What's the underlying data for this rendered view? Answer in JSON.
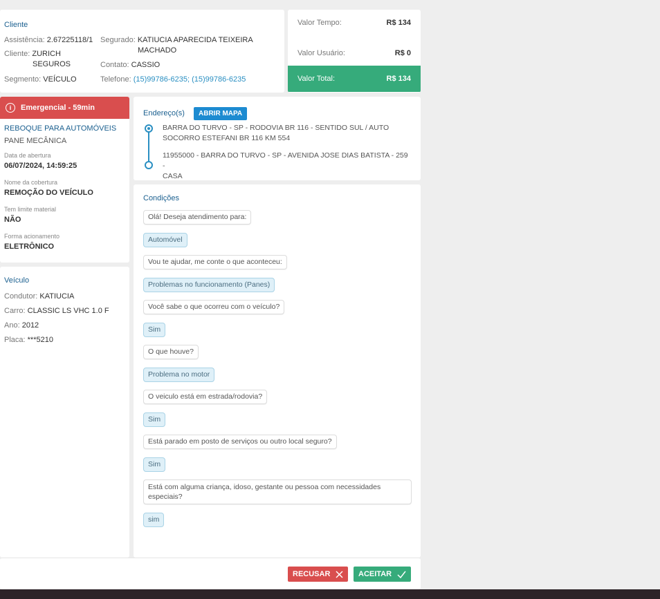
{
  "client": {
    "title": "Cliente",
    "assist_label": "Assistência:",
    "assist_value": "2.67225118/1",
    "client_label": "Cliente:",
    "client_value_1": "ZURICH",
    "client_value_2": "SEGUROS",
    "segment_label": "Segmento:",
    "segment_value": "VEÍCULO",
    "insured_label": "Segurado:",
    "insured_value_1": "KATIUCIA APARECIDA TEIXEIRA",
    "insured_value_2": "MACHADO",
    "contact_label": "Contato:",
    "contact_value": "CASSIO",
    "phone_label": "Telefone:",
    "phone_value": "(15)99786-6235; (15)99786-6235"
  },
  "values": {
    "time_label": "Valor Tempo:",
    "time_value": "R$ 134",
    "user_label": "Valor Usuário:",
    "user_value": "R$ 0",
    "total_label": "Valor Total:",
    "total_value": "R$ 134",
    "total_color": "#36ab7b"
  },
  "emergency": {
    "header": "Emergencial - 59min",
    "header_color": "#d94e4e",
    "icon": "info-icon",
    "service": "REBOQUE PARA AUTOMÓVEIS",
    "problem": "PANE MECÂNICA",
    "opened_label": "Data de abertura",
    "opened_value": "06/07/2024, 14:59:25",
    "coverage_label": "Nome da cobertura",
    "coverage_value": "REMOÇÃO DO VEÍCULO",
    "limit_label": "Tem limite material",
    "limit_value": "NÃO",
    "trigger_label": "Forma acionamento",
    "trigger_value": "ELETRÔNICO"
  },
  "vehicle": {
    "title": "Veículo",
    "driver_label": "Condutor:",
    "driver_value": "KATIUCIA",
    "car_label": "Carro:",
    "car_value": "CLASSIC LS VHC 1.0 F",
    "year_label": "Ano:",
    "year_value": "2012",
    "plate_label": "Placa:",
    "plate_value": "***5210"
  },
  "address": {
    "title": "Endereço(s)",
    "map_button": "ABRIR MAPA",
    "origin_1": "BARRA DO TURVO - SP - RODOVIA BR 116 - SENTIDO SUL / AUTO",
    "origin_2": "SOCORRO ESTEFANI BR 116 KM 554",
    "destination_1": "11955000 - BARRA DO TURVO - SP - AVENIDA JOSE DIAS BATISTA - 259 -",
    "destination_2": "CASA"
  },
  "conditions": {
    "title": "Condições",
    "messages": [
      {
        "type": "q",
        "text": "Olá! Deseja atendimento para:"
      },
      {
        "type": "a",
        "text": "Automóvel"
      },
      {
        "type": "q",
        "text": "Vou te ajudar, me conte o que aconteceu:"
      },
      {
        "type": "a",
        "text": "Problemas no funcionamento (Panes)"
      },
      {
        "type": "q",
        "text": "Você sabe o que ocorreu com o veículo?"
      },
      {
        "type": "a",
        "text": "Sim"
      },
      {
        "type": "q",
        "text": "O que houve?"
      },
      {
        "type": "a",
        "text": "Problema no motor"
      },
      {
        "type": "q",
        "text": "O veiculo está em estrada/rodovia?"
      },
      {
        "type": "a",
        "text": "Sim"
      },
      {
        "type": "q",
        "text": "Está parado em posto de serviços ou outro local seguro?"
      },
      {
        "type": "a",
        "text": "Sim"
      },
      {
        "type": "q",
        "text": "Está com alguma criança, idoso, gestante ou pessoa com necessidades especiais?"
      },
      {
        "type": "a",
        "text": "sim"
      }
    ]
  },
  "footer": {
    "refuse_label": "RECUSAR",
    "accept_label": "ACEITAR",
    "refuse_icon": "close-icon",
    "accept_icon": "check-icon"
  }
}
